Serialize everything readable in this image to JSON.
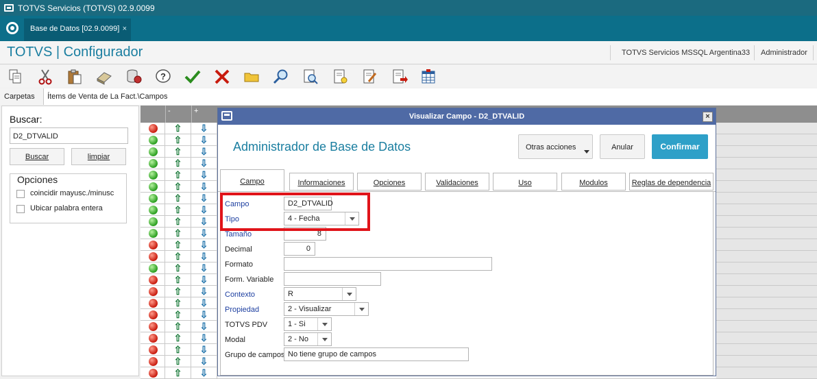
{
  "window": {
    "title": "TOTVS Servicios (TOTVS) 02.9.0099"
  },
  "tabbar": {
    "tab_label": "Base de Datos [02.9.0099]",
    "tab_close": "×"
  },
  "header": {
    "app_title": "TOTVS | Configurador",
    "server": "TOTVS Servicios MSSQL Argentina33",
    "user": "Administrador"
  },
  "toolbar": {
    "icons": [
      "copy-icon",
      "cut-icon",
      "paste-icon",
      "eraser-icon",
      "database-icon",
      "help-icon",
      "confirm-check-icon",
      "cancel-x-icon",
      "folder-icon",
      "search-icon",
      "preview-icon",
      "new-document-icon",
      "edit-document-icon",
      "export-document-icon",
      "table-icon"
    ]
  },
  "carpetas": {
    "label": "Carpetas",
    "path": "Ítems de Venta de La Fact.\\Campos"
  },
  "search_panel": {
    "label": "Buscar:",
    "value": "D2_DTVALID",
    "buscar_button": "Buscar",
    "limpiar_button": "limpiar",
    "options_label": "Opciones",
    "option_case": "coincidir mayusc./minusc",
    "option_whole": "Ubicar palabra entera"
  },
  "grid": {
    "header_minus": "-",
    "header_plus": "+",
    "up_glyph": "⇧",
    "down_glyph": "⇩",
    "rows": [
      "red",
      "green",
      "green",
      "green",
      "green",
      "green",
      "green",
      "green",
      "green",
      "green",
      "red",
      "red",
      "green",
      "red",
      "red",
      "red",
      "red",
      "red",
      "red",
      "red",
      "red",
      "red"
    ],
    "colors": {
      "green": "#2a9e1f",
      "red": "#c81b0e"
    }
  },
  "dialog": {
    "title": "Visualizar Campo - D2_DTVALID",
    "close": "×",
    "heading": "Administrador de Base de Datos",
    "otras_acciones": "Otras acciones",
    "anular": "Anular",
    "confirmar": "Confirmar",
    "tabs": [
      "Campo",
      "Informaciones",
      "Opciones",
      "Validaciones",
      "Uso",
      "Modulos",
      "Reglas de dependencia"
    ],
    "fields": {
      "campo": {
        "label": "Campo",
        "value": "D2_DTVALID"
      },
      "tipo": {
        "label": "Tipo",
        "value": "4 - Fecha"
      },
      "tamano": {
        "label": "Tamaño",
        "value": "8"
      },
      "decimal": {
        "label": "Decimal",
        "value": "0"
      },
      "formato": {
        "label": "Formato",
        "value": ""
      },
      "form_variable": {
        "label": "Form. Variable",
        "value": ""
      },
      "contexto": {
        "label": "Contexto",
        "value": "R"
      },
      "propiedad": {
        "label": "Propiedad",
        "value": "2 - Visualizar"
      },
      "totvs_pdv": {
        "label": "TOTVS PDV",
        "value": "1 - Si"
      },
      "modal": {
        "label": "Modal",
        "value": "2 - No"
      },
      "grupo": {
        "label": "Grupo de campos",
        "value": "No tiene grupo de campos"
      }
    }
  },
  "colors": {
    "accent": "#1a7ea0",
    "title_bar": "#1b6a7f",
    "tab_bar": "#0c6f8a",
    "dialog_title": "#4f6aa5",
    "confirm_button": "#2ea0c8",
    "highlight": "#e0141a"
  }
}
